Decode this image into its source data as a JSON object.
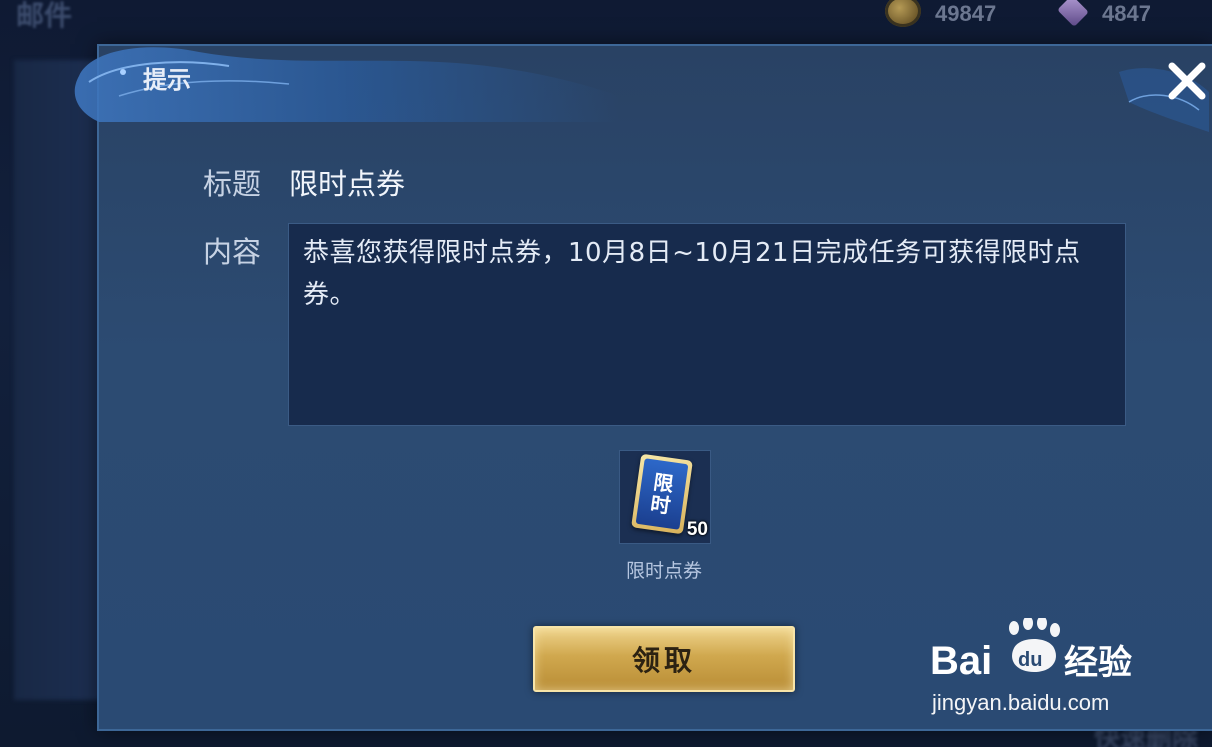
{
  "background": {
    "screen_title": "邮件",
    "coins": "49847",
    "gems": "4847",
    "bottom_text": "快速删除"
  },
  "dialog": {
    "title": "提示",
    "subject_label": "标题",
    "subject_value": "限时点券",
    "content_label": "内容",
    "content_text": "恭喜您获得限时点券，10月8日~10月21日完成任务可获得限时点券。",
    "reward": {
      "card_glyph_1": "限",
      "card_glyph_2": "时",
      "count": "50",
      "name": "限时点券"
    },
    "claim_label": "领取"
  },
  "watermark": {
    "brand": "Bai du 经验",
    "url": "jingyan.baidu.com"
  },
  "colors": {
    "dialog_bg": "#2a4a73",
    "button_gold": "#d0a84e",
    "content_bg": "#172b4d"
  }
}
